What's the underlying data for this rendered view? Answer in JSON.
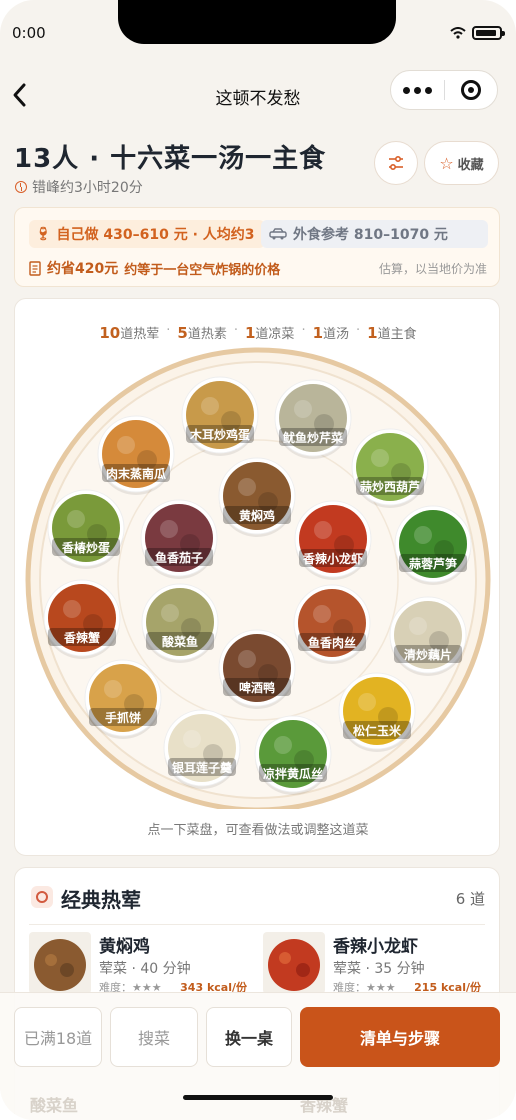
{
  "status": {
    "time": "0:00"
  },
  "nav": {
    "title": "这顿不发愁"
  },
  "header": {
    "headline": "13人 · 十六菜一汤一主食",
    "peak_time": "错峰约3小时20分",
    "fav_label": "收藏"
  },
  "cost": {
    "self_cook": "自己做 430–610 元 · 人均约3",
    "eat_out": "外食参考 810–1070 元",
    "savings_amount": "约省420元",
    "savings_desc": "约等于一台空气炸锅的价格",
    "note": "估算，以当地价为准"
  },
  "menu_counts": [
    {
      "num": "10",
      "label": "道热荤"
    },
    {
      "num": "5",
      "label": "道热素"
    },
    {
      "num": "1",
      "label": "道凉菜"
    },
    {
      "num": "1",
      "label": "道汤"
    },
    {
      "num": "1",
      "label": "道主食"
    }
  ],
  "platter": {
    "dishes": [
      {
        "name": "木耳炒鸡蛋",
        "color": "#c89a4a"
      },
      {
        "name": "鱿鱼炒芹菜",
        "color": "#b9b59a"
      },
      {
        "name": "肉末蒸南瓜",
        "color": "#d58a3a"
      },
      {
        "name": "蒜炒西葫芦",
        "color": "#8ab04c"
      },
      {
        "name": "黄焖鸡",
        "color": "#8a5a30"
      },
      {
        "name": "香椿炒蛋",
        "color": "#7a9a3a"
      },
      {
        "name": "鱼香茄子",
        "color": "#7a3a40"
      },
      {
        "name": "香辣小龙虾",
        "color": "#c23a20"
      },
      {
        "name": "蒜蓉芦笋",
        "color": "#3f8a2c"
      },
      {
        "name": "香辣蟹",
        "color": "#b8481e"
      },
      {
        "name": "酸菜鱼",
        "color": "#a6a46a"
      },
      {
        "name": "鱼香肉丝",
        "color": "#b5542c"
      },
      {
        "name": "清炒藕片",
        "color": "#d8d0b6"
      },
      {
        "name": "啤酒鸭",
        "color": "#7a4a30"
      },
      {
        "name": "手抓饼",
        "color": "#d8a24a"
      },
      {
        "name": "松仁玉米",
        "color": "#e2b322"
      },
      {
        "name": "银耳莲子羹",
        "color": "#e8e0c8"
      },
      {
        "name": "凉拌黄瓜丝",
        "color": "#5a9a3a"
      }
    ],
    "hint": "点一下菜盘，可查看做法或调整这道菜"
  },
  "section": {
    "title": "经典热荤",
    "count": "6 道",
    "dishes": [
      {
        "name": "黄焖鸡",
        "meta": "荤菜 · 40 分钟",
        "difficulty": "难度：★★★",
        "kcal": "343 kcal/份",
        "color": "#8a5a30"
      },
      {
        "name": "香辣小龙虾",
        "meta": "荤菜 · 35 分钟",
        "difficulty": "难度：★★★",
        "kcal": "215 kcal/份",
        "color": "#c23a20"
      }
    ]
  },
  "bottom": {
    "full_label": "已满18道",
    "search_label": "搜菜",
    "swap_label": "换一桌",
    "primary_label": "清单与步骤",
    "peek_left": "酸菜鱼",
    "peek_right": "香辣蟹"
  }
}
